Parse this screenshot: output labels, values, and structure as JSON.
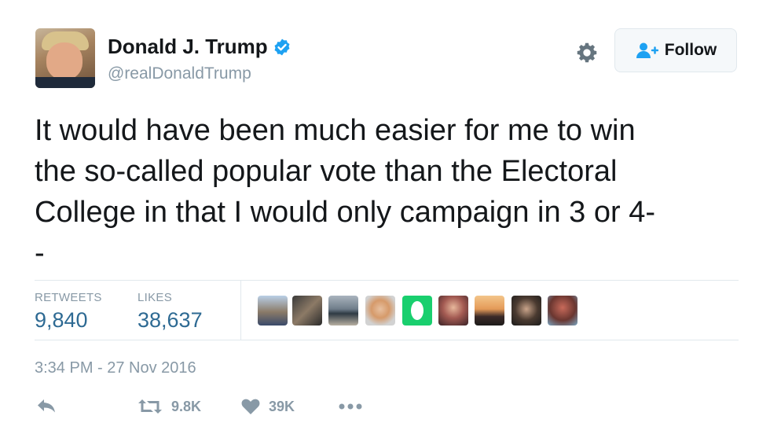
{
  "user": {
    "name": "Donald J. Trump",
    "handle": "@realDonaldTrump",
    "verified": true
  },
  "follow_button": {
    "label": "Follow",
    "icon": "follow-person-plus-icon"
  },
  "tweet": {
    "text": "It would have been much easier for me to win\nthe so-called popular vote than the Electoral\nCollege in that I would only campaign in 3 or 4-\n-",
    "timestamp": "3:34 PM - 27 Nov 2016"
  },
  "stats": {
    "retweets_label": "RETWEETS",
    "retweets_value": "9,840",
    "likes_label": "LIKES",
    "likes_value": "38,637"
  },
  "actions": {
    "retweet_count": "9.8K",
    "like_count": "39K"
  },
  "colors": {
    "verified_blue": "#1da1f2",
    "stat_value": "#2e6a93",
    "muted": "#8899a6",
    "divider": "#e1e8ed"
  }
}
